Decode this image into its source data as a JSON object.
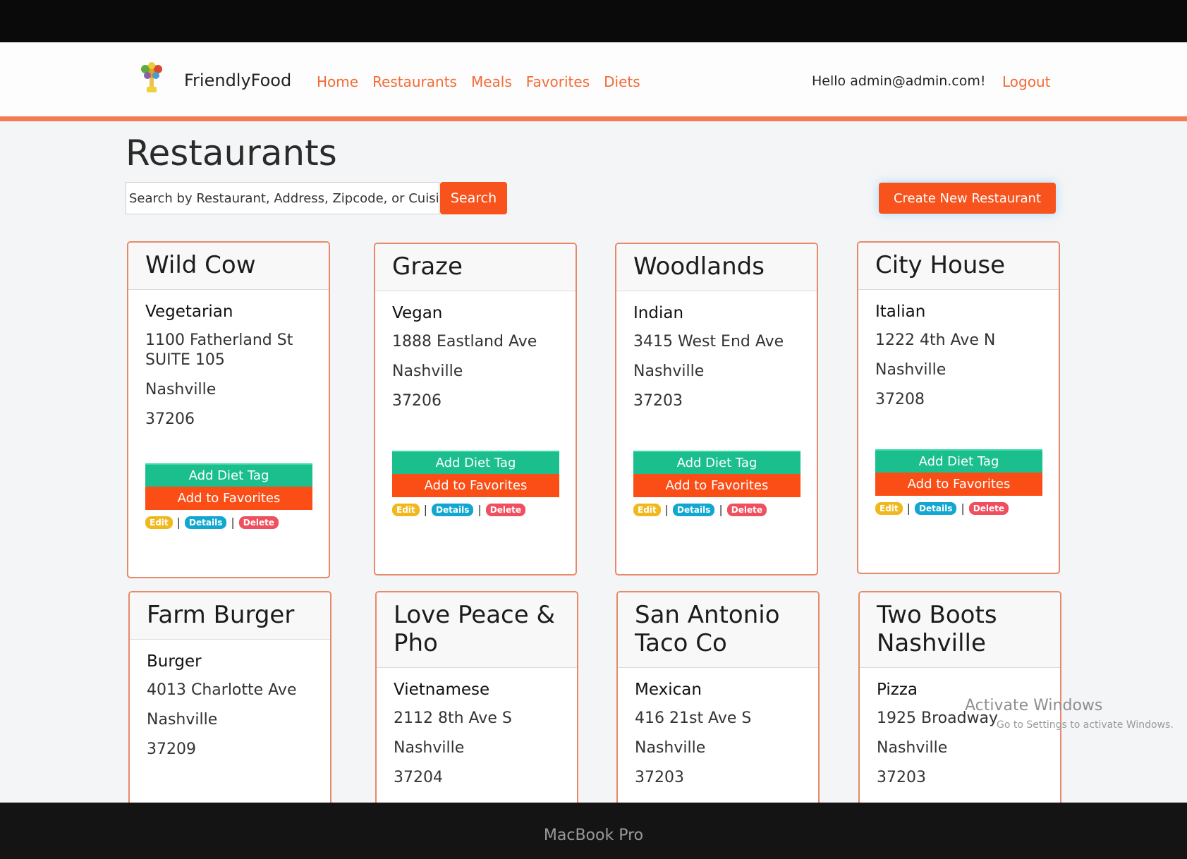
{
  "nav": {
    "brand": "FriendlyFood",
    "links": [
      "Home",
      "Restaurants",
      "Meals",
      "Favorites",
      "Diets"
    ],
    "greeting": "Hello admin@admin.com!",
    "logout": "Logout"
  },
  "page": {
    "title": "Restaurants",
    "search_placeholder": "Search by Restaurant, Address, Zipcode, or Cuisine",
    "search_button": "Search",
    "create_button": "Create New Restaurant"
  },
  "card_labels": {
    "add_diet_tag": "Add Diet Tag",
    "add_to_favorites": "Add to Favorites",
    "edit": "Edit",
    "details": "Details",
    "delete": "Delete",
    "separator": "|"
  },
  "restaurants": [
    {
      "name": "Wild Cow",
      "cuisine": "Vegetarian",
      "address": "1100 Fatherland St SUITE 105",
      "city": "Nashville",
      "zip": "37206"
    },
    {
      "name": "Graze",
      "cuisine": "Vegan",
      "address": "1888 Eastland Ave",
      "city": "Nashville",
      "zip": "37206"
    },
    {
      "name": "Woodlands",
      "cuisine": "Indian",
      "address": "3415 West End Ave",
      "city": "Nashville",
      "zip": "37203"
    },
    {
      "name": "City House",
      "cuisine": "Italian",
      "address": "1222 4th Ave N",
      "city": "Nashville",
      "zip": "37208"
    },
    {
      "name": "Farm Burger",
      "cuisine": "Burger",
      "address": "4013 Charlotte Ave",
      "city": "Nashville",
      "zip": "37209"
    },
    {
      "name": "Love Peace & Pho",
      "cuisine": "Vietnamese",
      "address": "2112 8th Ave S",
      "city": "Nashville",
      "zip": "37204"
    },
    {
      "name": "San Antonio Taco Co",
      "cuisine": "Mexican",
      "address": "416 21st Ave S",
      "city": "Nashville",
      "zip": "37203"
    },
    {
      "name": "Two Boots Nashville",
      "cuisine": "Pizza",
      "address": "1925 Broadway",
      "city": "Nashville",
      "zip": "37203"
    }
  ],
  "watermark": {
    "line1": "Activate Windows",
    "line2": "Go to Settings to activate Windows."
  },
  "device_label": "MacBook Pro",
  "colors": {
    "accent": "#f8531d",
    "diet_tag": "#1bbf8e",
    "edit": "#f1b81d",
    "details": "#12a7d0",
    "delete": "#ef4f5e"
  }
}
